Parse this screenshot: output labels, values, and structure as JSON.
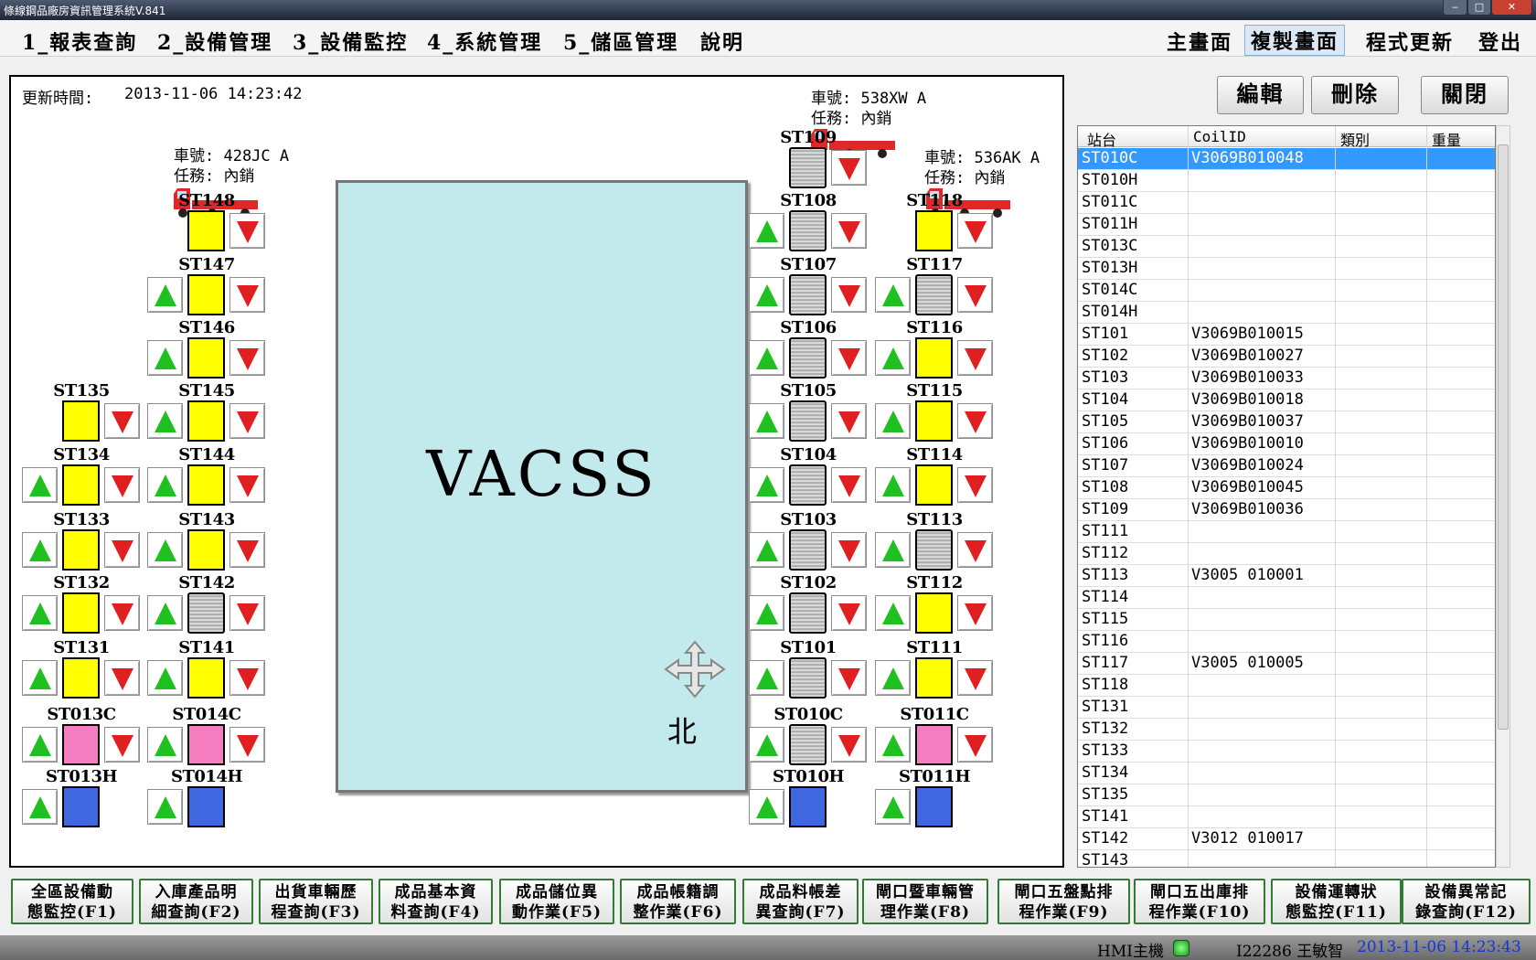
{
  "window": {
    "title": "條線鋼品廠房資訊管理系統V.841"
  },
  "menu_left": [
    "1_報表查詢",
    "2_設備管理",
    "3_設備監控",
    "4_系統管理",
    "5_儲區管理",
    "說明"
  ],
  "menu_right": [
    "主畫面",
    "複製畫面",
    "程式更新",
    "登出"
  ],
  "menu_active": "複製畫面",
  "panel": {
    "update_label": "更新時間:",
    "update_time": "2013-11-06 14:23:42",
    "vacss_label": "VACSS",
    "north_label": "北"
  },
  "trucks": [
    {
      "plate": "車號: 428JC  A",
      "task": "任務: 內銷"
    },
    {
      "plate": "車號: 538XW  A",
      "task": "任務: 內銷"
    },
    {
      "plate": "車號: 536AK  A",
      "task": "任務: 內銷"
    }
  ],
  "stations": [
    {
      "id": "ST148",
      "state": "yellow",
      "up": false,
      "down": true
    },
    {
      "id": "ST147",
      "state": "yellow",
      "up": true,
      "down": true
    },
    {
      "id": "ST146",
      "state": "yellow",
      "up": true,
      "down": true
    },
    {
      "id": "ST145",
      "state": "yellow",
      "up": true,
      "down": true
    },
    {
      "id": "ST144",
      "state": "yellow",
      "up": true,
      "down": true
    },
    {
      "id": "ST143",
      "state": "yellow",
      "up": true,
      "down": true
    },
    {
      "id": "ST142",
      "state": "coil",
      "up": true,
      "down": true
    },
    {
      "id": "ST141",
      "state": "yellow",
      "up": true,
      "down": true
    },
    {
      "id": "ST014C",
      "state": "pink",
      "up": true,
      "down": true
    },
    {
      "id": "ST014H",
      "state": "blue",
      "up": true,
      "down": false
    },
    {
      "id": "ST135",
      "state": "yellow",
      "up": false,
      "down": true
    },
    {
      "id": "ST134",
      "state": "yellow",
      "up": true,
      "down": true
    },
    {
      "id": "ST133",
      "state": "yellow",
      "up": true,
      "down": true
    },
    {
      "id": "ST132",
      "state": "yellow",
      "up": true,
      "down": true
    },
    {
      "id": "ST131",
      "state": "yellow",
      "up": true,
      "down": true
    },
    {
      "id": "ST013C",
      "state": "pink",
      "up": true,
      "down": true
    },
    {
      "id": "ST013H",
      "state": "blue",
      "up": true,
      "down": false
    },
    {
      "id": "ST109",
      "state": "coil",
      "up": false,
      "down": true
    },
    {
      "id": "ST108",
      "state": "coil",
      "up": true,
      "down": true
    },
    {
      "id": "ST107",
      "state": "coil",
      "up": true,
      "down": true
    },
    {
      "id": "ST106",
      "state": "coil",
      "up": true,
      "down": true
    },
    {
      "id": "ST105",
      "state": "coil",
      "up": true,
      "down": true
    },
    {
      "id": "ST104",
      "state": "coil",
      "up": true,
      "down": true
    },
    {
      "id": "ST103",
      "state": "coil",
      "up": true,
      "down": true
    },
    {
      "id": "ST102",
      "state": "coil",
      "up": true,
      "down": true
    },
    {
      "id": "ST101",
      "state": "coil",
      "up": true,
      "down": true
    },
    {
      "id": "ST010C",
      "state": "coil",
      "up": true,
      "down": true
    },
    {
      "id": "ST010H",
      "state": "blue",
      "up": true,
      "down": false
    },
    {
      "id": "ST118",
      "state": "yellow",
      "up": false,
      "down": true
    },
    {
      "id": "ST117",
      "state": "coil",
      "up": true,
      "down": true
    },
    {
      "id": "ST116",
      "state": "yellow",
      "up": true,
      "down": true
    },
    {
      "id": "ST115",
      "state": "yellow",
      "up": true,
      "down": true
    },
    {
      "id": "ST114",
      "state": "yellow",
      "up": true,
      "down": true
    },
    {
      "id": "ST113",
      "state": "coil",
      "up": true,
      "down": true
    },
    {
      "id": "ST112",
      "state": "yellow",
      "up": true,
      "down": true
    },
    {
      "id": "ST111",
      "state": "yellow",
      "up": true,
      "down": true
    },
    {
      "id": "ST011C",
      "state": "pink",
      "up": true,
      "down": true
    },
    {
      "id": "ST011H",
      "state": "blue",
      "up": true,
      "down": false
    }
  ],
  "state_colors": {
    "yellow": "#ffff00",
    "pink": "#f47ec0",
    "blue": "#3f68e0"
  },
  "actions": [
    "編輯",
    "刪除",
    "關閉"
  ],
  "table": {
    "headers": [
      "站台",
      "CoilID",
      "類別",
      "重量"
    ],
    "selected_row": 0,
    "rows": [
      [
        "ST010C",
        "V3069B010048"
      ],
      [
        "ST010H",
        ""
      ],
      [
        "ST011C",
        ""
      ],
      [
        "ST011H",
        ""
      ],
      [
        "ST013C",
        ""
      ],
      [
        "ST013H",
        ""
      ],
      [
        "ST014C",
        ""
      ],
      [
        "ST014H",
        ""
      ],
      [
        "ST101",
        "V3069B010015"
      ],
      [
        "ST102",
        "V3069B010027"
      ],
      [
        "ST103",
        "V3069B010033"
      ],
      [
        "ST104",
        "V3069B010018"
      ],
      [
        "ST105",
        "V3069B010037"
      ],
      [
        "ST106",
        "V3069B010010"
      ],
      [
        "ST107",
        "V3069B010024"
      ],
      [
        "ST108",
        "V3069B010045"
      ],
      [
        "ST109",
        "V3069B010036"
      ],
      [
        "ST111",
        ""
      ],
      [
        "ST112",
        ""
      ],
      [
        "ST113",
        "V3005 010001"
      ],
      [
        "ST114",
        ""
      ],
      [
        "ST115",
        ""
      ],
      [
        "ST116",
        ""
      ],
      [
        "ST117",
        "V3005 010005"
      ],
      [
        "ST118",
        ""
      ],
      [
        "ST131",
        ""
      ],
      [
        "ST132",
        ""
      ],
      [
        "ST133",
        ""
      ],
      [
        "ST134",
        ""
      ],
      [
        "ST135",
        ""
      ],
      [
        "ST141",
        ""
      ],
      [
        "ST142",
        "V3012 010017"
      ],
      [
        "ST143",
        ""
      ]
    ]
  },
  "fkeys": [
    [
      "全區設備動",
      "態監控(F1)"
    ],
    [
      "入庫產品明",
      "細查詢(F2)"
    ],
    [
      "出貨車輛歷",
      "程查詢(F3)"
    ],
    [
      "成品基本資",
      "料查詢(F4)"
    ],
    [
      "成品儲位異",
      "動作業(F5)"
    ],
    [
      "成品帳籍調",
      "整作業(F6)"
    ],
    [
      "成品料帳差",
      "異查詢(F7)"
    ],
    [
      "閘口暨車輛管",
      "理作業(F8)"
    ],
    [
      "閘口五盤點排",
      "程作業(F9)"
    ],
    [
      "閘口五出庫排",
      "程作業(F10)"
    ],
    [
      "設備運轉狀",
      "態監控(F11)"
    ],
    [
      "設備異常記",
      "錄查詢(F12)"
    ]
  ],
  "status": {
    "host": "HMI主機",
    "user": "I22286 王敏智",
    "time": "2013-11-06 14:23:43"
  }
}
